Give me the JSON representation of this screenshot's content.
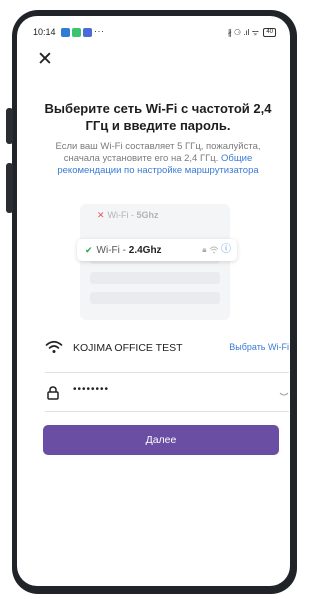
{
  "status_bar": {
    "time": "10:14",
    "more": "···",
    "signal_icons": "∦ ⚆ .ıl ᯤ",
    "battery": "40"
  },
  "title": "Выберите сеть Wi-Fi с частотой 2,4 ГГц и введите пароль.",
  "description": {
    "text": "Если ваш Wi-Fi составляет 5 ГГц, пожалуйста, сначала установите его на 2,4 ГГц.",
    "link": "Общие рекомендации по настройке маршрутизатора"
  },
  "illustration": {
    "wifi_5": {
      "name": "Wi-Fi - ",
      "band": "5Ghz"
    },
    "wifi_24": {
      "name": "Wi-Fi - ",
      "band": "2.4Ghz"
    }
  },
  "network": {
    "ssid": "KOJIMA OFFICE TEST",
    "choose_label": "Выбрать Wi-Fi"
  },
  "password": {
    "masked": "••••••••"
  },
  "next_button": "Далее",
  "colors": {
    "accent": "#6a4ea3",
    "link": "#3a7bd5",
    "check": "#28a745",
    "cross": "#e05555"
  },
  "icons": [
    "close-icon",
    "wifi-icon",
    "lock-icon",
    "eye-hidden-icon",
    "info-icon",
    "check-icon",
    "cross-icon"
  ]
}
